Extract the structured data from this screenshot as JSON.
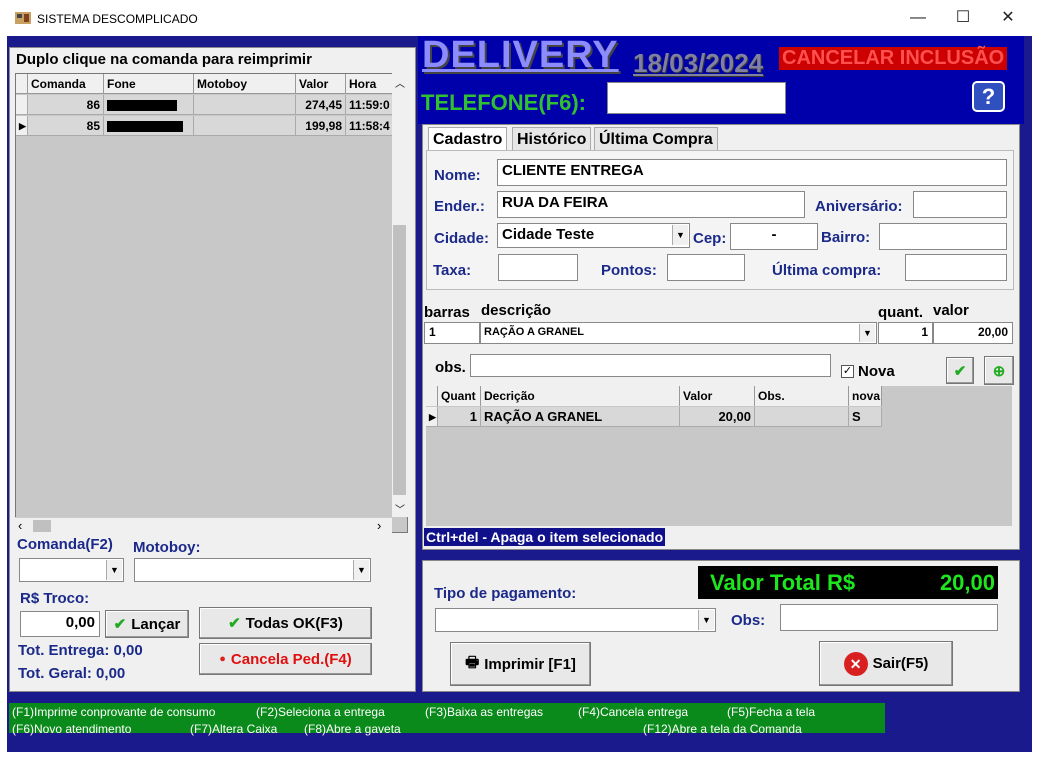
{
  "window": {
    "title": "SISTEMA DESCOMPLICADO",
    "minimize": "—",
    "maximize": "☐",
    "close": "✕"
  },
  "left": {
    "header": "Duplo clique na comanda para reimprimir",
    "columns": [
      "Comanda",
      "Fone",
      "Motoboy",
      "Valor",
      "Hora"
    ],
    "rows": [
      {
        "comanda": "86",
        "fone": "",
        "motoboy": "",
        "valor": "274,45",
        "hora": "11:59:0"
      },
      {
        "comanda": "85",
        "fone": "",
        "motoboy": "",
        "valor": "199,98",
        "hora": "11:58:4"
      }
    ],
    "comanda_label": "Comanda(F2)",
    "motoboy_label": "Motoboy:",
    "troco_label": "R$ Troco:",
    "troco_value": "0,00",
    "lancar": "Lançar",
    "todas_ok": "Todas OK(F3)",
    "tot_entrega": "Tot. Entrega: 0,00",
    "cancela_ped": "Cancela Ped.(F4)",
    "tot_geral": "Tot. Geral: 0,00"
  },
  "header": {
    "delivery": "DELIVERY",
    "date": "18/03/2024",
    "cancelar": "CANCELAR INCLUSÃO",
    "telefone": "TELEFONE(F6):",
    "help": "?"
  },
  "tabs": [
    "Cadastro",
    "Histórico",
    "Última Compra"
  ],
  "cadastro": {
    "nome_label": "Nome:",
    "nome": "CLIENTE ENTREGA",
    "ender_label": "Ender.:",
    "ender": "RUA DA FEIRA",
    "aniversario_label": "Aniversário:",
    "cidade_label": "Cidade:",
    "cidade": "Cidade Teste",
    "cep_label": "Cep:",
    "cep": "-",
    "bairro_label": "Bairro:",
    "taxa_label": "Taxa:",
    "pontos_label": "Pontos:",
    "ultima_label": "Última compra:"
  },
  "item": {
    "barras_label": "barras",
    "descricao_label": "descrição",
    "quant_label": "quant.",
    "valor_label": "valor",
    "barras": "1",
    "descricao": "RAÇÃO A GRANEL",
    "quant": "1",
    "valor": "20,00",
    "obs_label": "obs.",
    "nova_label": "Nova"
  },
  "items_table": {
    "columns": [
      "Quant",
      "Decrição",
      "Valor",
      "Obs.",
      "nova"
    ],
    "rows": [
      {
        "quant": "1",
        "desc": "RAÇÃO A GRANEL",
        "valor": "20,00",
        "obs": "",
        "nova": "S"
      }
    ]
  },
  "hint": "Ctrl+del - Apaga o item selecionado",
  "payment": {
    "tipo_label": "Tipo de pagamento:",
    "valor_total_label": "Valor Total R$",
    "valor_total": "20,00",
    "obs_label": "Obs:",
    "imprimir": "Imprimir [F1]",
    "sair": "Sair(F5)"
  },
  "status": {
    "f1": "(F1)Imprime conprovante de consumo",
    "f2": "(F2)Seleciona a entrega",
    "f3": "(F3)Baixa as entregas",
    "f4": "(F4)Cancela entrega",
    "f5": "(F5)Fecha a tela",
    "f6": "(F6)Novo atendimento",
    "f7": "(F7)Altera Caixa",
    "f8": "(F8)Abre a gaveta",
    "f12": "(F12)Abre a tela da Comanda"
  }
}
